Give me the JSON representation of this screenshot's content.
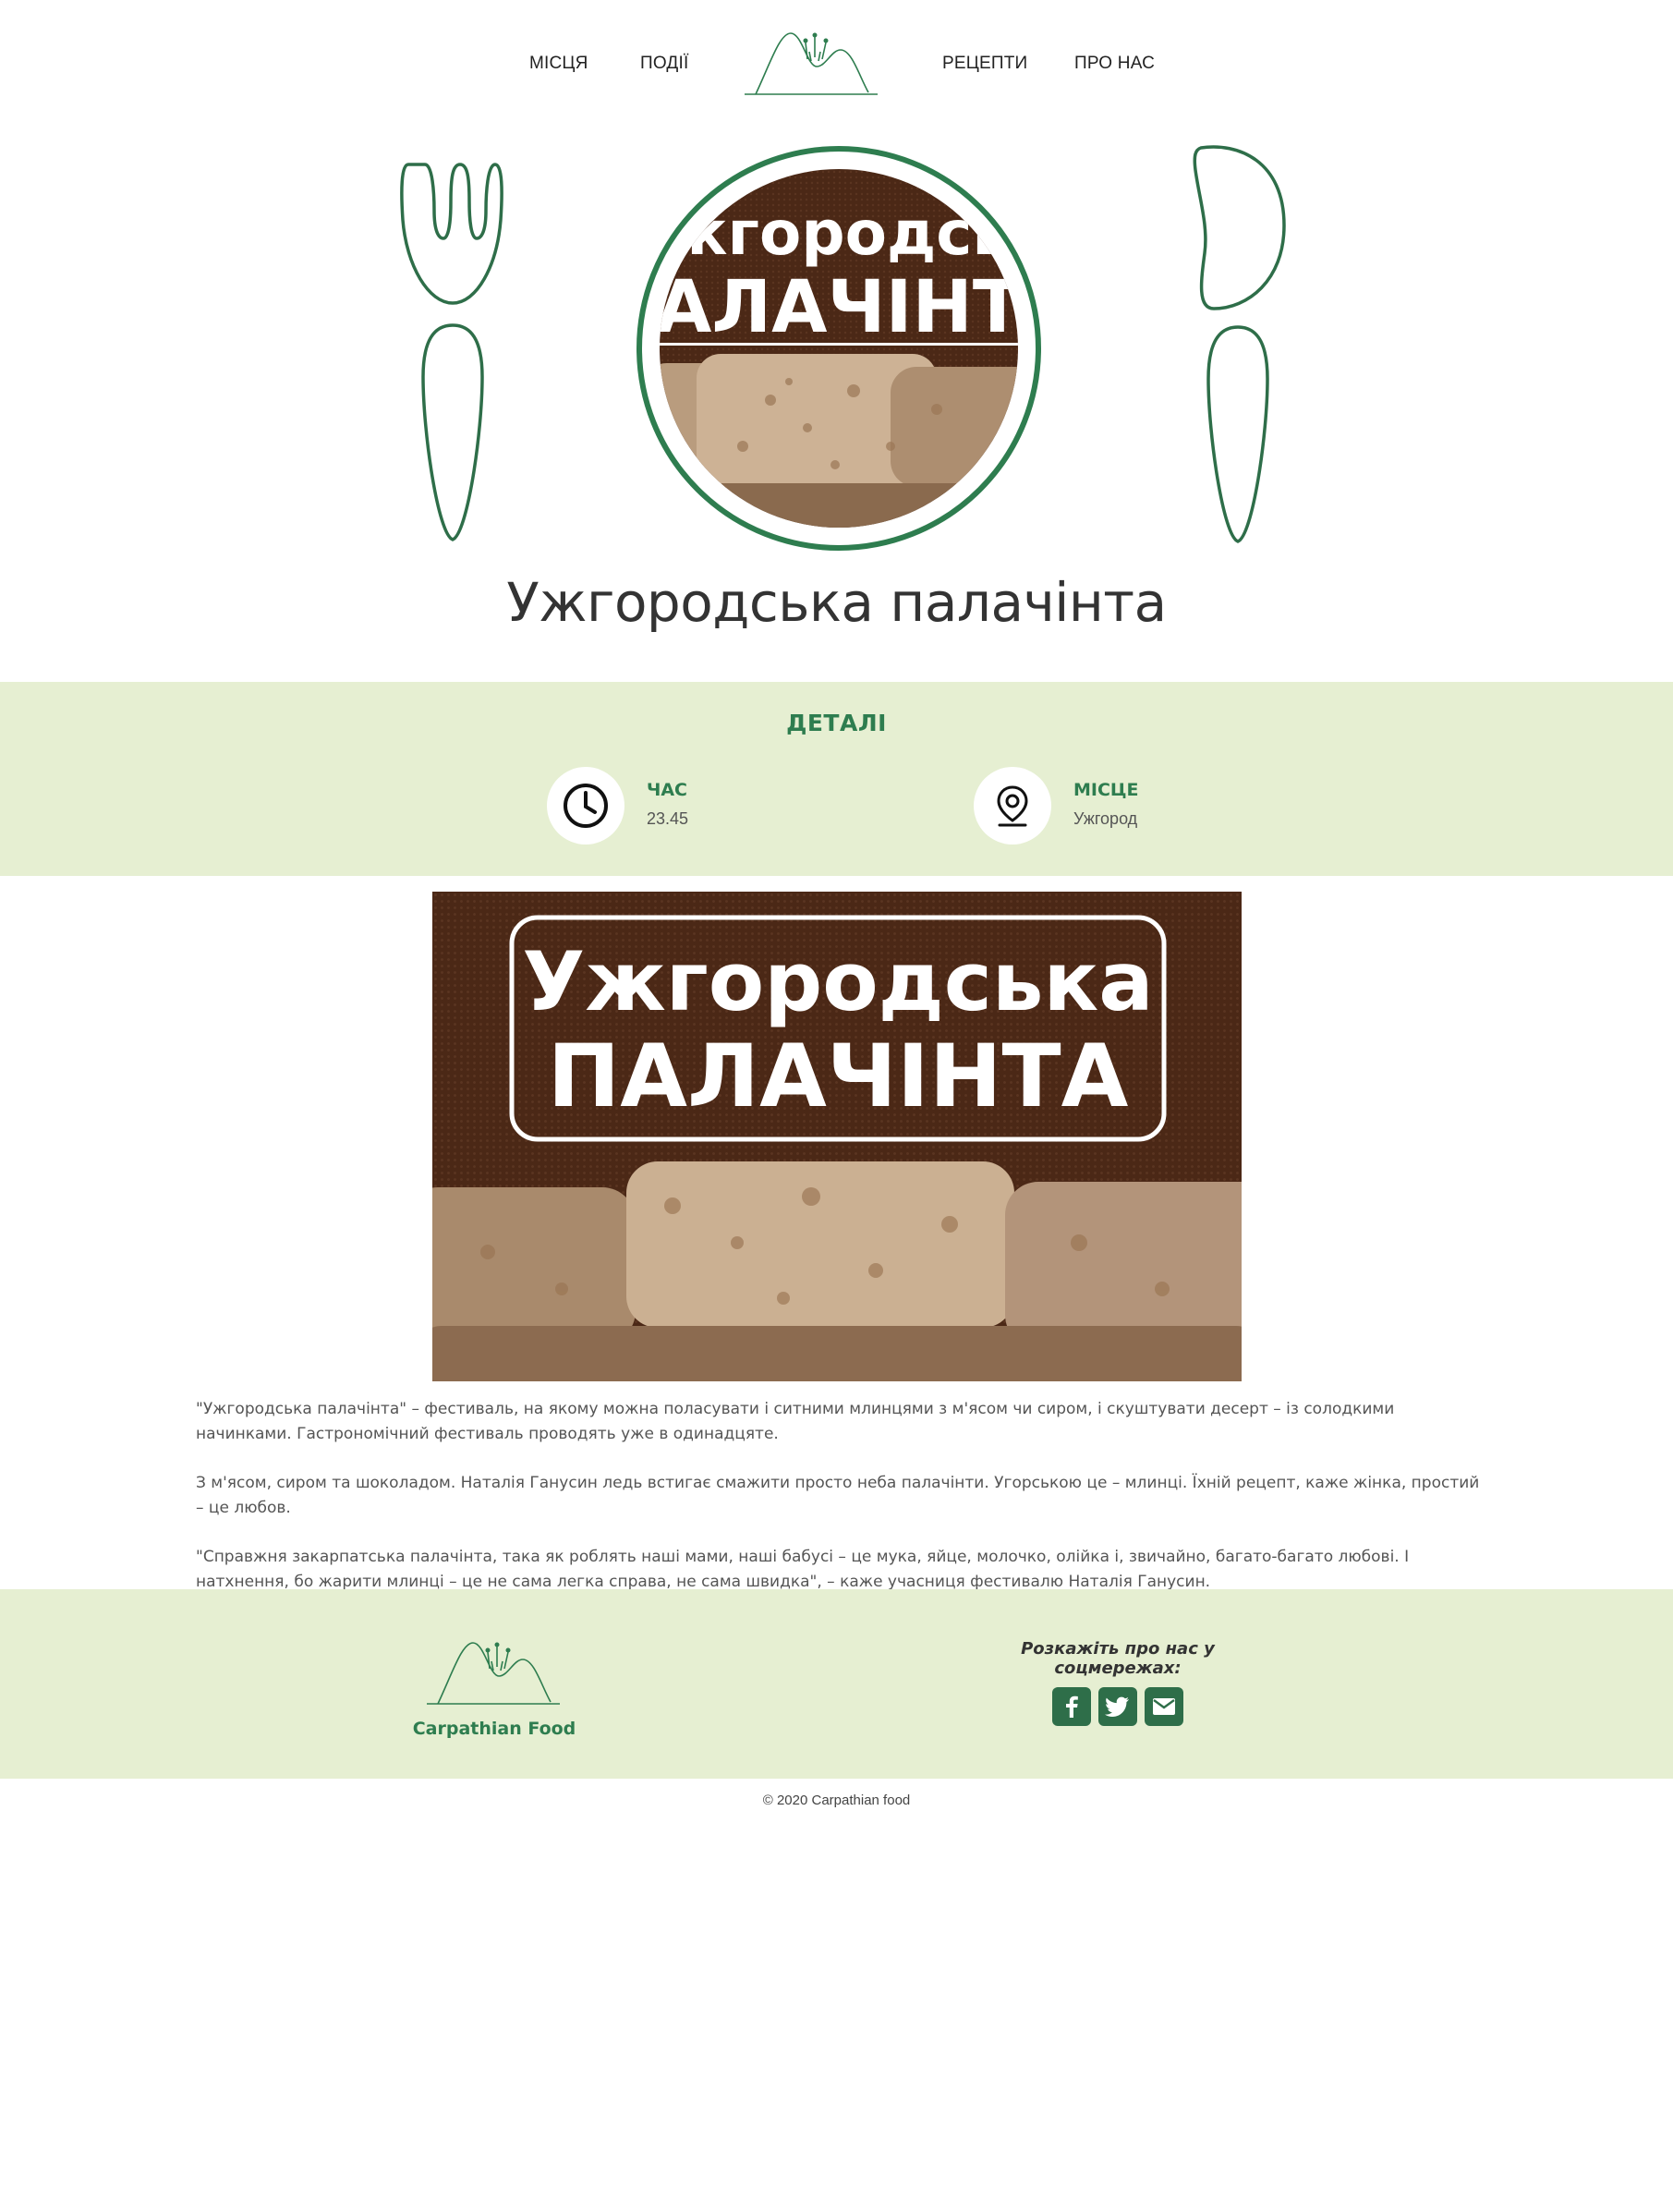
{
  "nav": {
    "items": [
      "МІСЦЯ",
      "ПОДІЇ",
      "РЕЦЕПТИ",
      "ПРО НАС"
    ]
  },
  "hero": {
    "plate_text_line1": "жгородсь",
    "plate_text_line2": "АЛАЧІНТ",
    "title": "Ужгородська палачінта"
  },
  "details": {
    "heading": "ДЕТАЛІ",
    "time_label": "ЧАС",
    "time_value": "23.45",
    "place_label": "МІСЦЕ",
    "place_value": "Ужгород"
  },
  "banner": {
    "line1": "Ужгородська",
    "line2": "ПАЛАЧІНТА"
  },
  "description": [
    "\"Ужгородська палачінта\" – фестиваль, на якому можна поласувати і ситними млинцями з м'ясом чи сиром, і скуштувати десерт – із солодкими начинками. Гастрономічний фестиваль проводять уже в одинадцяте.",
    "З м'ясом, сиром та шоколадом. Наталія Ганусин ледь встигає смажити просто неба палачінти. Угорською це – млинці. Їхній рецепт, каже жінка, простий – це любов.",
    "\"Справжня закарпатська палачінта, така як роблять наші мами, наші бабусі – це мука, яйце, молочко, олійка і, звичайно, багато-багато любові. І натхнення, бо жарити млинці – це не сама легка справа, не сама швидка\", – каже учасниця фестивалю Наталія Ганусин."
  ],
  "footer": {
    "brand": "Carpathian Food",
    "share": "Розкажіть про нас у соцмережах:",
    "social": [
      "facebook-icon",
      "twitter-icon",
      "mail-icon"
    ],
    "copyright": "© 2020 Carpathian food"
  },
  "colors": {
    "accent": "#2e7d4f",
    "panel": "#e6efd2",
    "brown": "#4a2a17"
  }
}
